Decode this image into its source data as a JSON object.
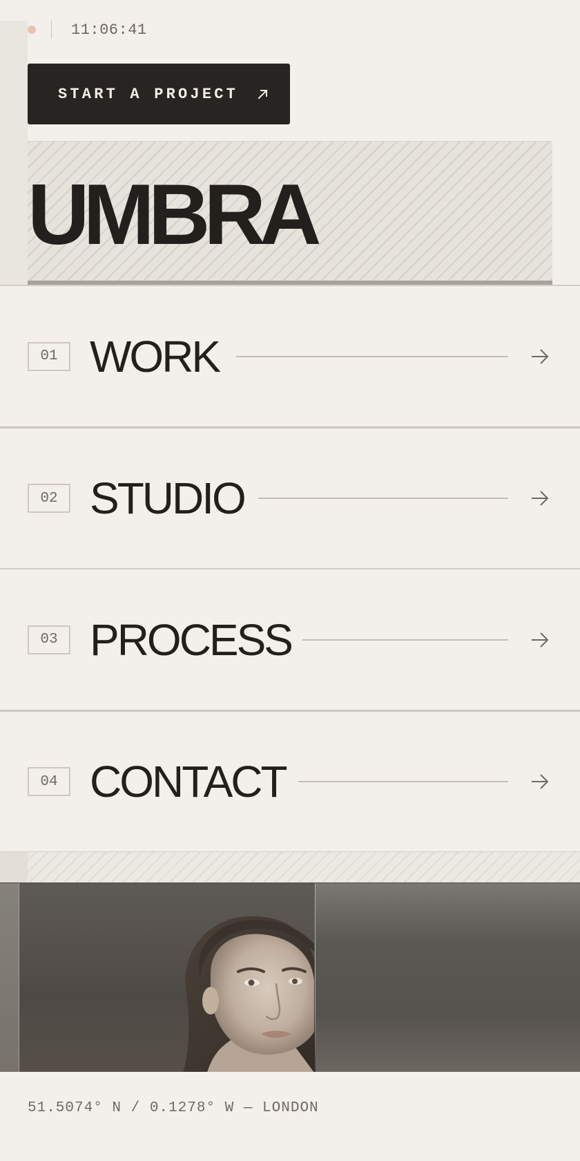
{
  "status": {
    "time": "11:06:41"
  },
  "cta": {
    "label": "START A PROJECT",
    "icon": "arrow-up-right-icon"
  },
  "brand": {
    "name": "UMBRA"
  },
  "nav": {
    "items": [
      {
        "number": "01",
        "label": "WORK",
        "icon": "arrow-right-icon"
      },
      {
        "number": "02",
        "label": "STUDIO",
        "icon": "arrow-right-icon"
      },
      {
        "number": "03",
        "label": "PROCESS",
        "icon": "arrow-right-icon"
      },
      {
        "number": "04",
        "label": "CONTACT",
        "icon": "arrow-right-icon"
      }
    ]
  },
  "footer": {
    "coordinates": "51.5074° N / 0.1278° W — LONDON"
  },
  "colors": {
    "background": "#f3f0eb",
    "ink": "#231f1c",
    "cta_background": "#282421",
    "status_dot": "#e8c2b4"
  }
}
